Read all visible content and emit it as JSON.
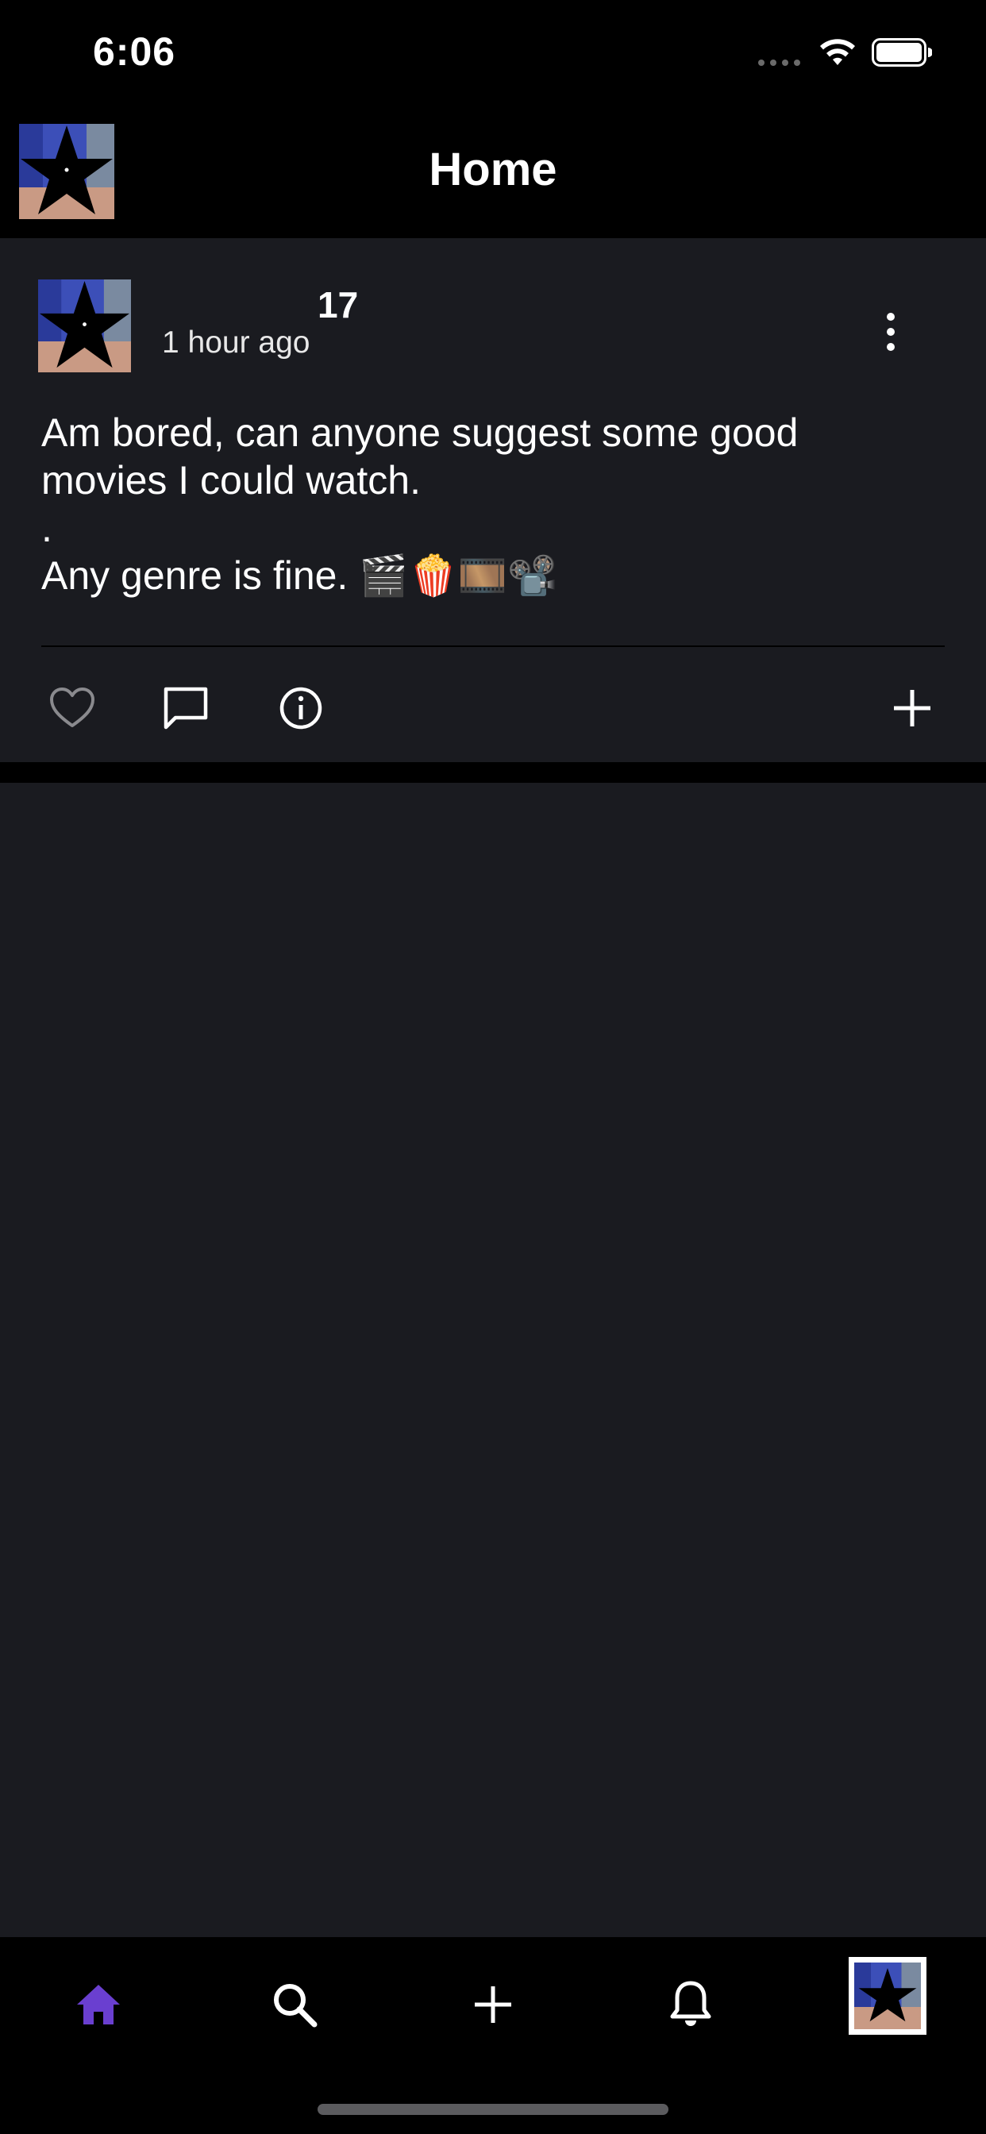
{
  "status_bar": {
    "time": "6:06"
  },
  "header": {
    "title": "Home"
  },
  "post": {
    "username": "17",
    "timestamp": "1 hour ago",
    "body_lines": [
      "Am bored, can anyone suggest some good",
      "movies I could watch.",
      ".",
      "Any genre is fine. 🎬🍿🎞️📽️"
    ],
    "liked": false
  },
  "icons": {
    "avatar": "star-avatar-icon",
    "more": "more-vertical-icon",
    "like": "heart-icon",
    "comment": "comment-icon",
    "info": "info-icon",
    "add": "plus-icon"
  },
  "tabs": [
    {
      "name": "home",
      "icon": "home-icon",
      "active": true
    },
    {
      "name": "search",
      "icon": "search-icon",
      "active": false
    },
    {
      "name": "create",
      "icon": "plus-icon",
      "active": false
    },
    {
      "name": "notifications",
      "icon": "bell-icon",
      "active": false
    },
    {
      "name": "profile",
      "icon": "avatar",
      "active": false
    }
  ],
  "colors": {
    "accent": "#6a3fd0",
    "background": "#1a1b20",
    "bar": "#000000",
    "text": "#ffffff",
    "muted_icon": "#8a8a8e"
  }
}
